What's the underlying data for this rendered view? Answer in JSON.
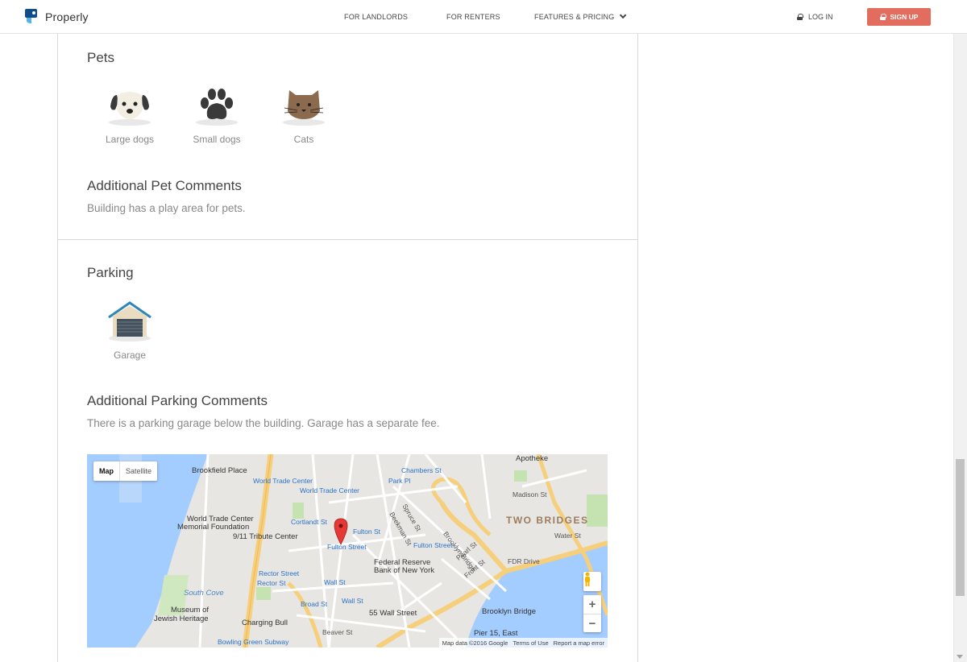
{
  "header": {
    "brand": "Properly",
    "nav": [
      "FOR LANDLORDS",
      "FOR RENTERS",
      "FEATURES & PRICING"
    ],
    "login_label": "LOG IN",
    "signup_label": "SIGN UP",
    "accent_color": "#e26c5e"
  },
  "pets": {
    "title": "Pets",
    "items": [
      {
        "label": "Large dogs",
        "icon": "large-dog-icon"
      },
      {
        "label": "Small dogs",
        "icon": "paw-print-icon"
      },
      {
        "label": "Cats",
        "icon": "cat-icon"
      }
    ],
    "comments_title": "Additional Pet Comments",
    "comments": "Building has a play area for pets."
  },
  "parking": {
    "title": "Parking",
    "items": [
      {
        "label": "Garage",
        "icon": "garage-icon"
      }
    ],
    "comments_title": "Additional Parking Comments",
    "comments": "There is a parking garage below the building. Garage has a separate fee."
  },
  "map": {
    "type_map": "Map",
    "type_satellite": "Satellite",
    "zoom_in": "+",
    "zoom_out": "−",
    "footer": [
      "Map data ©2016 Google",
      "Terms of Use",
      "Report a map error"
    ],
    "labels": {
      "brookfield": "Brookfield Place",
      "wtc": "World Trade Center",
      "wtc2": "World Trade Center",
      "wtc_memorial_1": "World Trade Center",
      "wtc_memorial_2": "Memorial Foundation",
      "tribute": "9/11 Tribute Center",
      "chambers": "Chambers St",
      "park_pl": "Park Pl",
      "cortlandt": "Cortlandt St",
      "fulton_st": "Fulton St",
      "fulton_street": "Fulton Street",
      "fulton_st2": "Fulton Street",
      "federal_1": "Federal Reserve",
      "federal_2": "Bank of New York",
      "rector1": "Rector Street",
      "rector2": "Rector St",
      "wall_st": "Wall St",
      "broad_st": "Broad St",
      "wall_st2": "Wall St",
      "fifty_five": "55 Wall Street",
      "south_cove": "South Cove",
      "museum_1": "Museum of",
      "museum_2": "Jewish Heritage",
      "charging_bull": "Charging Bull",
      "bowling_green": "Bowling Green Subway",
      "apotheke": "Apotheke",
      "two_bridges": "TWO BRIDGES",
      "madison": "Madison St",
      "water_st": "Water St",
      "fdr": "FDR Drive",
      "brooklyn_bridge": "Brooklyn Bridge",
      "brooklyn_bridge2": "Brooklyn Bridge",
      "pier15": "Pier 15, East",
      "spruce": "Spruce St",
      "beekman": "Beekman St",
      "pearl": "Pearl St",
      "front": "Front St",
      "beaver": "Beaver St"
    }
  }
}
